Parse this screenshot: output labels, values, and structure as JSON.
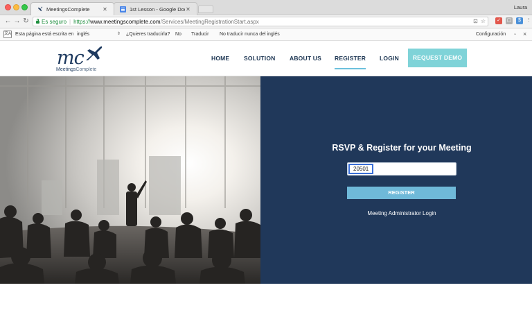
{
  "browser": {
    "tabs": [
      {
        "title": "MeetingsComplete",
        "active": true
      },
      {
        "title": "1st Lesson - Google Docs",
        "active": false
      }
    ],
    "profile_name": "Laura",
    "security_label": "Es seguro",
    "url": {
      "scheme": "https://",
      "host": "www.meetingscomplete.com",
      "path": "/Services/MeetingRegistrationStart.aspx"
    },
    "translate_bar": {
      "prompt": "Esta página está escrita en",
      "language": "inglés",
      "question": "¿Quieres traducirla?",
      "no": "No",
      "translate": "Traducir",
      "never": "No traducir nunca del inglés",
      "settings": "Configuración"
    }
  },
  "site": {
    "logo": {
      "mark": "mc",
      "name_bold": "Meetings",
      "name_light": "Complete",
      "icon": "airplane-icon"
    },
    "nav": [
      {
        "label": "HOME"
      },
      {
        "label": "SOLUTION"
      },
      {
        "label": "ABOUT US"
      },
      {
        "label": "REGISTER",
        "active": true
      },
      {
        "label": "LOGIN"
      }
    ],
    "demo_button": "REQUEST DEMO",
    "colors": {
      "navy": "#20385a",
      "nav_text": "#1c3552",
      "teal": "#7fd3d8",
      "button_blue": "#6fb9d9"
    }
  },
  "hero": {
    "title": "RSVP & Register for your Meeting",
    "code_value": "20501",
    "register_label": "REGISTER",
    "admin_link": "Meeting Administrator Login"
  }
}
